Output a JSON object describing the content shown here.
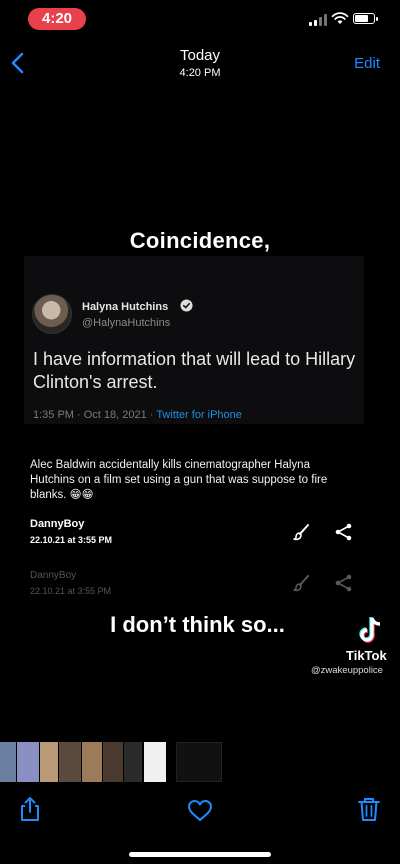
{
  "status_bar": {
    "time": "4:20"
  },
  "nav": {
    "title": "Today",
    "subtitle": "4:20 PM",
    "edit_label": "Edit"
  },
  "media": {
    "caption_top": "Coincidence,",
    "tweet": {
      "author_name": "Halyna Hutchins",
      "handle": "@HalynaHutchins",
      "text": "I have information that will lead to Hillary Clinton's arrest.",
      "meta_time": "1:35 PM · Oct 18, 2021 · ",
      "meta_source": "Twitter for iPhone"
    },
    "comment_text": "Alec Baldwin accidentally kills cinematographer Halyna Hutchins on a film set using a gun that was suppose to fire blanks. 😁😁",
    "comments": [
      {
        "user": "DannyBoy",
        "date": "22.10.21 at 3:55 PM"
      },
      {
        "user": "DannyBoy",
        "date": "22.10.21 at 3:55 PM"
      }
    ],
    "caption_bottom": "I don’t think so...",
    "watermark": {
      "brand": "TikTok",
      "handle": "@zwakeuppolice"
    }
  },
  "icons": {
    "back": "chevron-left-icon",
    "share": "share-icon",
    "favorite": "heart-icon",
    "delete": "trash-icon",
    "brush": "brush-icon",
    "share_node": "share-nodes-icon"
  },
  "colors": {
    "accent": "#1a8cff",
    "time_pill": "#e8414b",
    "link": "#1d8fe0"
  }
}
